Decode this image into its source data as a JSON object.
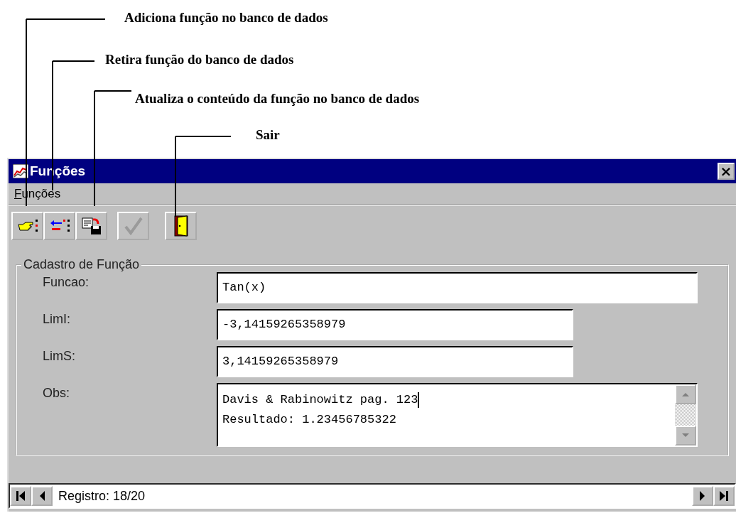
{
  "callouts": [
    {
      "text": "Adiciona função no banco de dados"
    },
    {
      "text": "Retira função do banco de dados"
    },
    {
      "text": "Atualiza o conteúdo da função no banco de dados"
    },
    {
      "text": "Sair"
    }
  ],
  "window": {
    "title": "Funções",
    "close": "×"
  },
  "menu": [
    {
      "label": "Funções"
    }
  ],
  "toolbar": [
    {
      "kind": "add",
      "disabled": false
    },
    {
      "kind": "remove",
      "disabled": false
    },
    {
      "kind": "update",
      "disabled": false
    },
    {
      "kind": "confirm",
      "disabled": true
    },
    {
      "kind": "exit",
      "disabled": false
    }
  ],
  "group": {
    "title": "Cadastro de Função",
    "fields": [
      {
        "label": "Funcao:",
        "kind": "wide",
        "value": "Tan(x)"
      },
      {
        "label": "LimI:",
        "kind": "narrow",
        "value": "-3,14159265358979"
      },
      {
        "label": "LimS:",
        "kind": "narrow",
        "value": "3,14159265358979"
      },
      {
        "label": "Obs:",
        "kind": "memo",
        "lines": [
          "Davis & Rabinowitz pag. 123",
          "Resultado: 1.23456785322"
        ]
      }
    ]
  },
  "status_bar": {
    "text": "Registro: 18/20"
  }
}
